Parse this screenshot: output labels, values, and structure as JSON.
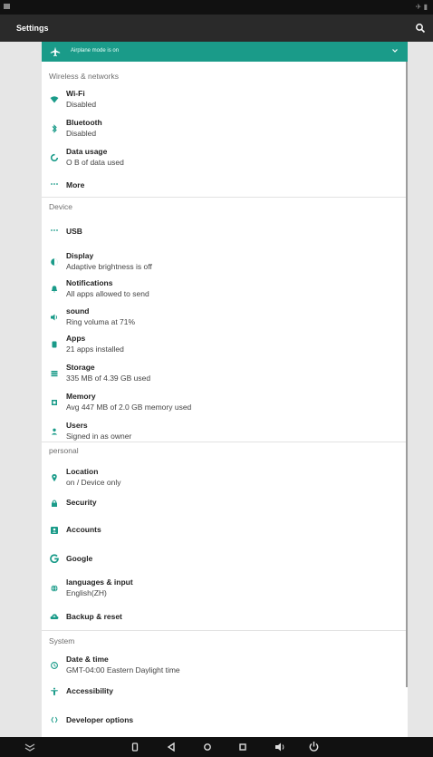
{
  "app_title": "Settings",
  "banner": {
    "text": "Airplane mode is on"
  },
  "sections": [
    {
      "header": "Wireless & networks",
      "items": [
        {
          "title": "Wi-Fi",
          "subtitle": "Disabled"
        },
        {
          "title": "Bluetooth",
          "subtitle": "Disabled"
        },
        {
          "title": "Data usage",
          "subtitle": "O B of data used"
        },
        {
          "title": "More",
          "subtitle": ""
        }
      ]
    },
    {
      "header": "Device",
      "items": [
        {
          "title": "USB",
          "subtitle": ""
        },
        {
          "title": "Display",
          "subtitle": "Adaptive brightness is off"
        },
        {
          "title": "Notifications",
          "subtitle": "All apps allowed to send"
        },
        {
          "title": "sound",
          "subtitle": "Ring voluma at 71%"
        },
        {
          "title": "Apps",
          "subtitle": "21 apps installed"
        },
        {
          "title": "Storage",
          "subtitle": "335 MB of 4.39 GB used"
        },
        {
          "title": "Memory",
          "subtitle": "Avg 447 MB of 2.0 GB memory used"
        },
        {
          "title": "Users",
          "subtitle": "Signed in as owner"
        }
      ]
    },
    {
      "header": "personal",
      "items": [
        {
          "title": "Location",
          "subtitle": "on / Device only"
        },
        {
          "title": "Security",
          "subtitle": ""
        },
        {
          "title": "Accounts",
          "subtitle": ""
        },
        {
          "title": "Google",
          "subtitle": ""
        },
        {
          "title": "languages & input",
          "subtitle": "English(ZH)"
        },
        {
          "title": "Backup & reset",
          "subtitle": ""
        }
      ]
    },
    {
      "header": "System",
      "items": [
        {
          "title": "Date & time",
          "subtitle": "GMT-04:00 Eastern Daylight time"
        },
        {
          "title": "Accessibility",
          "subtitle": ""
        },
        {
          "title": "Developer options",
          "subtitle": ""
        }
      ]
    }
  ],
  "icons": {
    "airplane": "airplane-icon",
    "wifi": "wifi-icon",
    "bluetooth": "bluetooth-icon",
    "data": "data-usage-icon",
    "more": "more-icon",
    "usb": "usb-icon",
    "display": "display-icon",
    "notifications": "notifications-icon",
    "sound": "sound-icon",
    "apps": "apps-icon",
    "storage": "storage-icon",
    "memory": "memory-icon",
    "users": "users-icon",
    "location": "location-icon",
    "security": "lock-icon",
    "accounts": "accounts-icon",
    "google": "google-icon",
    "language": "globe-icon",
    "backup": "cloud-icon",
    "date": "clock-icon",
    "accessibility": "accessibility-icon",
    "developer": "code-icon"
  },
  "colors": {
    "accent": "#1a9b89",
    "action_bar": "#2a2a2a",
    "status_bar": "#111111"
  }
}
